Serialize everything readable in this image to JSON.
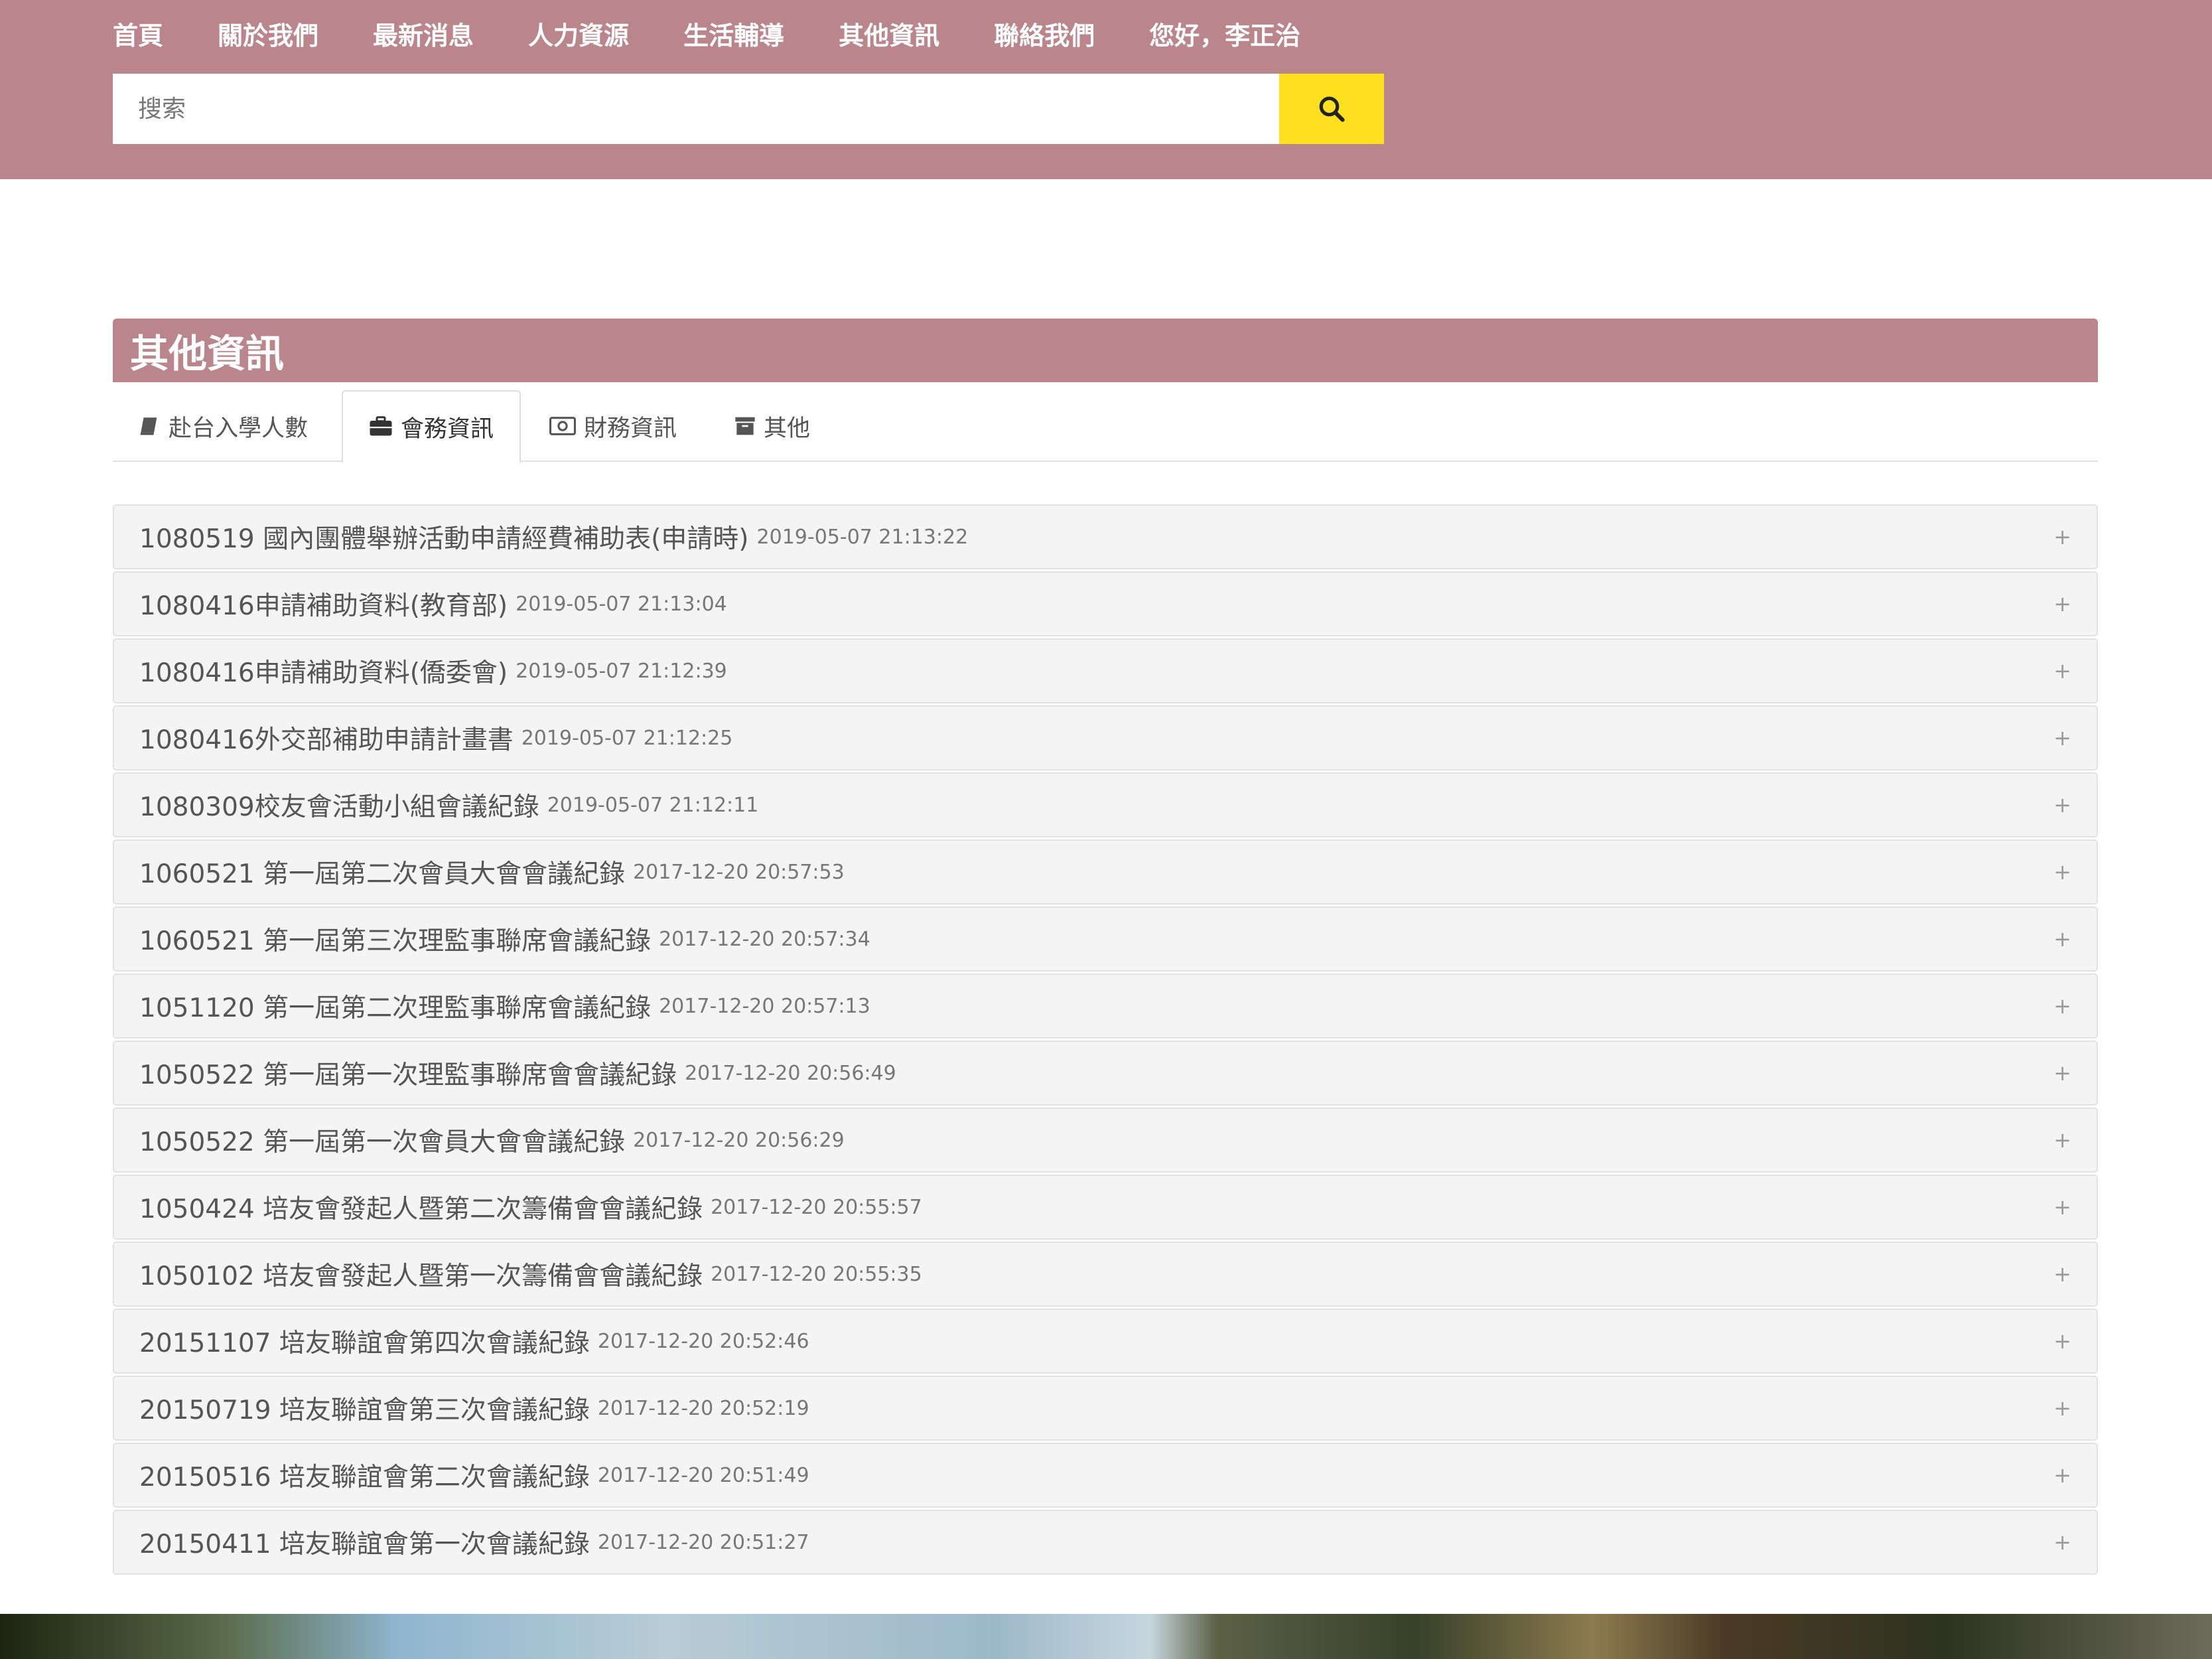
{
  "nav": {
    "items": [
      "首頁",
      "關於我們",
      "最新消息",
      "人力資源",
      "生活輔導",
      "其他資訊",
      "聯絡我們",
      "您好，李正治"
    ]
  },
  "search": {
    "placeholder": "搜索",
    "button_icon": "search-icon"
  },
  "section": {
    "title": "其他資訊"
  },
  "tabs": [
    {
      "label": "赴台入學人數",
      "icon": "book-icon",
      "active": false
    },
    {
      "label": "會務資訊",
      "icon": "briefcase-icon",
      "active": true
    },
    {
      "label": "財務資訊",
      "icon": "money-icon",
      "active": false
    },
    {
      "label": "其他",
      "icon": "archive-icon",
      "active": false
    }
  ],
  "items": [
    {
      "title": "1080519 國內團體舉辦活動申請經費補助表(申請時)",
      "date": "2019-05-07 21:13:22"
    },
    {
      "title": "1080416申請補助資料(教育部)",
      "date": "2019-05-07 21:13:04"
    },
    {
      "title": "1080416申請補助資料(僑委會)",
      "date": "2019-05-07 21:12:39"
    },
    {
      "title": "1080416外交部補助申請計畫書",
      "date": "2019-05-07 21:12:25"
    },
    {
      "title": "1080309校友會活動小組會議紀錄",
      "date": "2019-05-07 21:12:11"
    },
    {
      "title": "1060521 第一屆第二次會員大會會議紀錄",
      "date": "2017-12-20 20:57:53"
    },
    {
      "title": "1060521 第一屆第三次理監事聯席會議紀錄",
      "date": "2017-12-20 20:57:34"
    },
    {
      "title": "1051120 第一屆第二次理監事聯席會議紀錄",
      "date": "2017-12-20 20:57:13"
    },
    {
      "title": "1050522 第一屆第一次理監事聯席會會議紀錄",
      "date": "2017-12-20 20:56:49"
    },
    {
      "title": "1050522 第一屆第一次會員大會會議紀錄",
      "date": "2017-12-20 20:56:29"
    },
    {
      "title": "1050424 培友會發起人暨第二次籌備會會議紀錄",
      "date": "2017-12-20 20:55:57"
    },
    {
      "title": "1050102 培友會發起人暨第一次籌備會會議紀錄",
      "date": "2017-12-20 20:55:35"
    },
    {
      "title": "20151107 培友聯誼會第四次會議紀錄",
      "date": "2017-12-20 20:52:46"
    },
    {
      "title": "20150719 培友聯誼會第三次會議紀錄",
      "date": "2017-12-20 20:52:19"
    },
    {
      "title": "20150516 培友聯誼會第二次會議紀錄",
      "date": "2017-12-20 20:51:49"
    },
    {
      "title": "20150411 培友聯誼會第一次會議紀錄",
      "date": "2017-12-20 20:51:27"
    }
  ],
  "expand_symbol": "+",
  "colors": {
    "header_bg": "#bb858c",
    "search_button": "#ffe01e",
    "row_bg": "#f4f4f4"
  }
}
